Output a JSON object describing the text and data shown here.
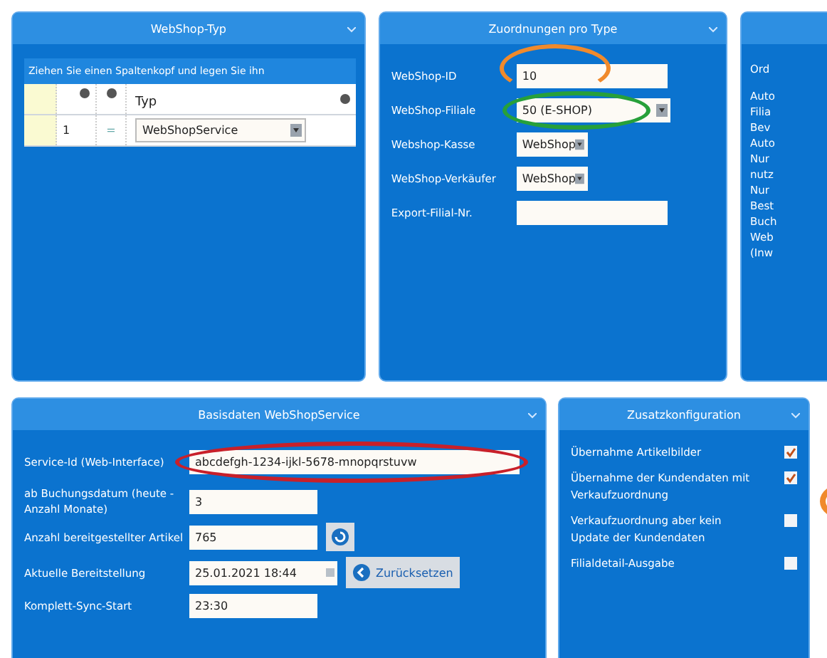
{
  "panels": [
    {
      "title": "WebShop-Typ",
      "kind": "grid",
      "group_hint": "Ziehen Sie einen Spaltenkopf und legen Sie ihn",
      "columns": [
        "Typ"
      ],
      "rows": [
        {
          "number": "1",
          "marker": "=",
          "type": "WebShopService"
        }
      ]
    },
    {
      "title": "Zuordnungen pro Type",
      "kind": "form",
      "fields": [
        {
          "label": "WebShop-ID",
          "value": "10",
          "kind": "input"
        },
        {
          "label": "WebShop-Filiale",
          "value": "50 (E-SHOP)",
          "kind": "select"
        },
        {
          "label": "Webshop-Kasse",
          "value": "WebShop",
          "kind": "select"
        },
        {
          "label": "WebShop-Verkäufer",
          "value": "WebShop",
          "kind": "select"
        },
        {
          "label": "Export-Filial-Nr.",
          "kind": "input"
        }
      ]
    },
    {
      "kind": "cut",
      "lines": [
        "Ord",
        "Auto",
        "Filia",
        "Bev",
        "Auto",
        "Nur",
        "nutz",
        "Nur",
        "Best",
        "Buch",
        "Web",
        "(Inw"
      ]
    }
  ],
  "basisdaten": {
    "title": "Basisdaten WebShopService",
    "fields": [
      {
        "label": "Service-Id (Web-Interface)",
        "value": "abcdefgh-1234-ijkl-5678-mnopqrstuvw",
        "kind": "wide"
      },
      {
        "label": "ab Buchungsdatum (heute - Anzahl Monate)",
        "value": "3",
        "kind": "input"
      },
      {
        "label": "Anzahl bereitgestellter Artikel",
        "value": "765",
        "kind": "refresh"
      },
      {
        "label": "Aktuelle Bereitstellung",
        "value": "25.01.2021 18:44",
        "kind": "reset",
        "button": "Zurücksetzen"
      },
      {
        "label": "Komplett-Sync-Start",
        "value": "23:30",
        "kind": "input"
      }
    ]
  },
  "zusatz": {
    "title": "Zusatzkonfiguration",
    "options": [
      {
        "label": "Übernahme Artikelbilder",
        "checked": true
      },
      {
        "label": "Übernahme der Kundendaten mit Verkaufzuordnung",
        "checked": true
      },
      {
        "label": "Verkaufzuordnung aber kein Update der Kundendaten",
        "checked": false
      },
      {
        "label": "Filialdetail-Ausgabe",
        "checked": false
      }
    ]
  }
}
